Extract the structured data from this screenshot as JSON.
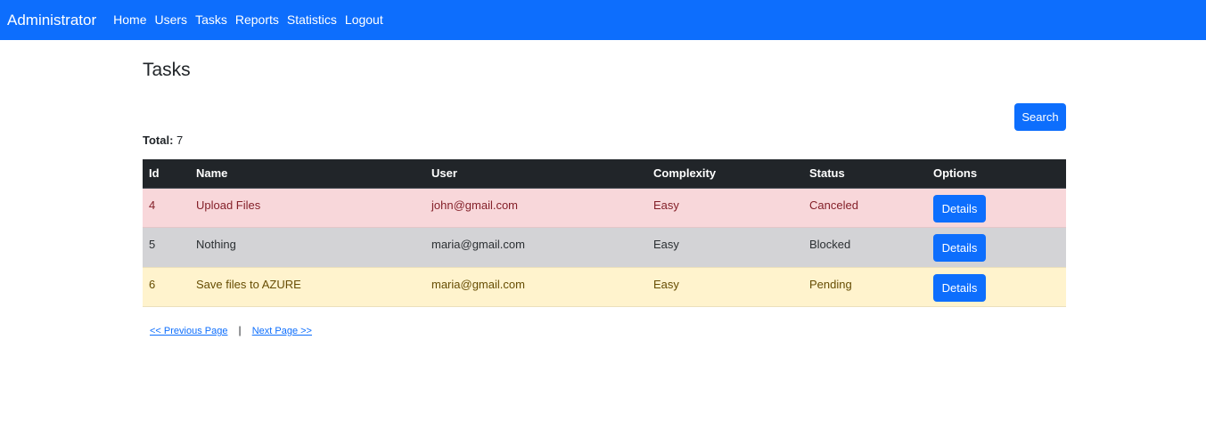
{
  "navbar": {
    "brand": "Administrator",
    "links": [
      "Home",
      "Users",
      "Tasks",
      "Reports",
      "Statistics",
      "Logout"
    ]
  },
  "page": {
    "title": "Tasks",
    "search_label": "Search",
    "total_label": "Total:",
    "total_value": "7"
  },
  "table": {
    "headers": [
      "Id",
      "Name",
      "User",
      "Complexity",
      "Status",
      "Options"
    ],
    "rows": [
      {
        "id": "4",
        "name": "Upload Files",
        "user": "john@gmail.com",
        "complexity": "Easy",
        "status": "Canceled",
        "action": "Details"
      },
      {
        "id": "5",
        "name": "Nothing",
        "user": "maria@gmail.com",
        "complexity": "Easy",
        "status": "Blocked",
        "action": "Details"
      },
      {
        "id": "6",
        "name": "Save files to AZURE",
        "user": "maria@gmail.com",
        "complexity": "Easy",
        "status": "Pending",
        "action": "Details"
      }
    ]
  },
  "pager": {
    "prev": "<< Previous Page",
    "separator": "|",
    "next": "Next Page >>"
  },
  "colors": {
    "primary": "#0d6efd",
    "header_dark": "#212529",
    "row_canceled": "#f8d7da",
    "row_blocked": "#d3d3d6",
    "row_pending": "#fff3cd"
  }
}
